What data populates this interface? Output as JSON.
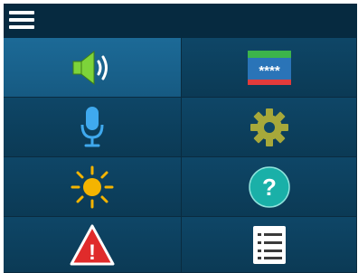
{
  "topbar": {
    "menu_icon": "hamburger-menu-icon"
  },
  "tiles": [
    {
      "name": "sound-tile",
      "icon": "speaker-volume-icon",
      "selected": true
    },
    {
      "name": "passcode-tile",
      "icon": "passcode-keypad-icon",
      "text": "****",
      "selected": false
    },
    {
      "name": "voice-tile",
      "icon": "microphone-icon",
      "selected": false
    },
    {
      "name": "settings-tile",
      "icon": "gear-icon",
      "selected": false
    },
    {
      "name": "brightness-tile",
      "icon": "sun-brightness-icon",
      "selected": false
    },
    {
      "name": "help-tile",
      "icon": "help-question-icon",
      "text": "?",
      "selected": false
    },
    {
      "name": "alert-tile",
      "icon": "warning-triangle-icon",
      "text": "!",
      "selected": false
    },
    {
      "name": "list-tile",
      "icon": "list-icon",
      "selected": false
    }
  ],
  "colors": {
    "background": "#0b3a55",
    "topbar": "#062a40",
    "selected_tile": "#1c6a97",
    "speaker_green": "#7dd33a",
    "mic_blue": "#3fa9ee",
    "gear_olive": "#a7a83a",
    "sun_yellow": "#f4b400",
    "help_teal": "#1ab0a8",
    "warning_red": "#e02b2b"
  }
}
